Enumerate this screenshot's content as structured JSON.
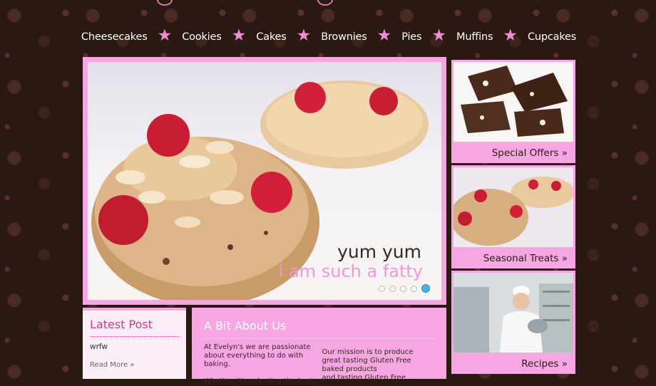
{
  "nav": {
    "items": [
      "Cheesecakes",
      "Cookies",
      "Cakes",
      "Brownies",
      "Pies",
      "Muffins",
      "Cupcakes"
    ],
    "separator": "★"
  },
  "slider": {
    "caption_line1": "yum yum",
    "caption_line2": "i am such a fatty",
    "dot_count": 5,
    "active_dot": 5
  },
  "side_cards": [
    {
      "label": "Special Offers »",
      "image": "chocolate-brownie-pieces"
    },
    {
      "label": "Seasonal Treats »",
      "image": "cherry-cookies"
    },
    {
      "label": "Recipes »",
      "image": "chef-in-kitchen"
    }
  ],
  "latest_post": {
    "title": "Latest Post",
    "post_title": "wrfw",
    "read_more": "Read More »"
  },
  "about": {
    "title": "A Bit About Us",
    "col1": "At Evelyn's we are passionate about everything to do with baking.",
    "col1_cont": "Whether it's selecting the best",
    "col2": "Our mission is to produce great tasting Gluten Free baked products",
    "col2_cont": "and tasting Gluten Free"
  },
  "colors": {
    "accent_pink": "#f6a6e3",
    "background": "#2a1812",
    "star": "#f38bd6",
    "heading_pink": "#c43e8e"
  }
}
